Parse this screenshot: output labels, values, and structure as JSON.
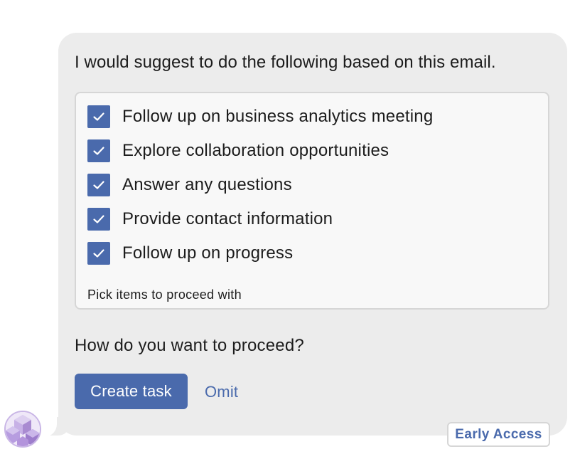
{
  "message": {
    "intro": "I would suggest to do the following based on this email."
  },
  "picker": {
    "items": [
      {
        "label": "Follow up on business analytics meeting",
        "checked": true
      },
      {
        "label": "Explore collaboration opportunities",
        "checked": true
      },
      {
        "label": "Answer any questions",
        "checked": true
      },
      {
        "label": "Provide contact information",
        "checked": true
      },
      {
        "label": "Follow up on progress",
        "checked": true
      }
    ],
    "hint": "Pick items to proceed with"
  },
  "prompt": {
    "question": "How do you want to proceed?"
  },
  "actions": {
    "create_label": "Create task",
    "omit_label": "Omit"
  },
  "badge": {
    "label": "Early Access"
  },
  "icons": {
    "check": "checkmark-icon",
    "avatar": "assistant-avatar-icon"
  },
  "colors": {
    "accent": "#4a6aac",
    "bubble": "#ececec",
    "avatar": "#a98bd1"
  }
}
